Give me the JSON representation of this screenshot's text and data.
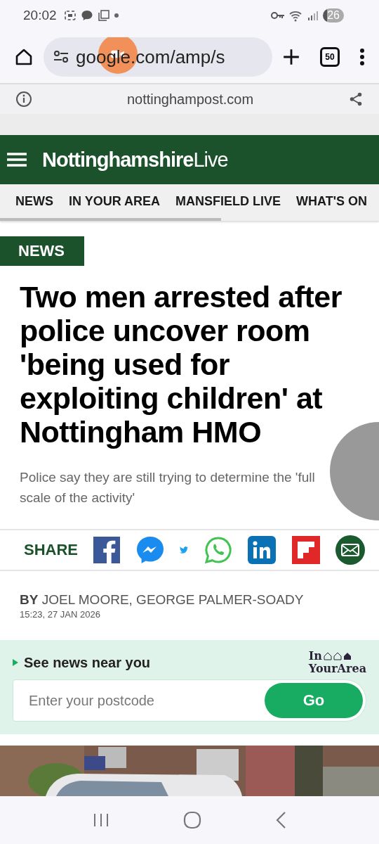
{
  "status_bar": {
    "time": "20:02",
    "battery": "26"
  },
  "browser": {
    "url": "google.com/amp/s",
    "tab_count": "50",
    "domain": "nottinghampost.com"
  },
  "site": {
    "brand_main": "Nottinghamshire",
    "brand_suffix": "Live",
    "nav": [
      {
        "label": "NEWS"
      },
      {
        "label": "IN YOUR AREA"
      },
      {
        "label": "MANSFIELD LIVE"
      },
      {
        "label": "WHAT'S ON"
      }
    ]
  },
  "article": {
    "section": "NEWS",
    "headline": "Two men arrested after police uncover room 'being used for exploiting children' at Nottingham HMO",
    "standfirst": "Police say they are still trying to determine the 'full scale of the activity'",
    "share_label": "SHARE",
    "share_buttons": [
      {
        "kind": "facebook"
      },
      {
        "kind": "messenger"
      },
      {
        "kind": "twitter"
      },
      {
        "kind": "whatsapp"
      },
      {
        "kind": "linkedin"
      },
      {
        "kind": "flipboard"
      },
      {
        "kind": "email"
      }
    ],
    "byline_prefix": "BY",
    "authors": "JOEL MOORE, GEORGE PALMER-SOADY",
    "timestamp": "15:23, 27 JAN 2026"
  },
  "in_your_area": {
    "title": "See news near you",
    "logo_line1": "In",
    "logo_line2": "YourArea",
    "placeholder": "Enter your postcode",
    "button": "Go"
  }
}
